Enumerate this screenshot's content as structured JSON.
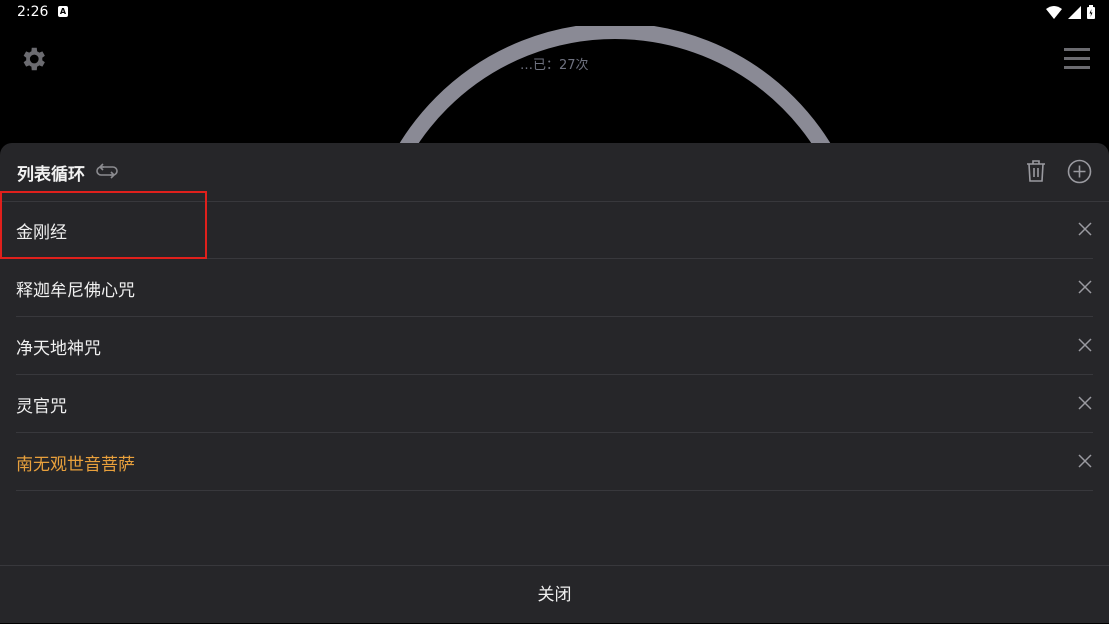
{
  "status_bar": {
    "time": "2:26",
    "notification_icon": "a-box-icon",
    "icons": [
      "wifi-icon",
      "signal-icon",
      "battery-icon"
    ]
  },
  "background": {
    "counter_text": "…已：27次",
    "left_icon": "gear-icon",
    "right_icon": "menu-icon",
    "refresh_icon": "refresh-icon",
    "accent_ring_color": "#8a8a95",
    "glow_color": "#1e3a9e"
  },
  "sheet": {
    "title": "列表循环",
    "title_icon": "loop-icon",
    "actions": [
      "trash-icon",
      "add-circle-icon"
    ],
    "items": [
      {
        "label": "金刚经",
        "active": false
      },
      {
        "label": "释迦牟尼佛心咒",
        "active": false
      },
      {
        "label": "净天地神咒",
        "active": false
      },
      {
        "label": "灵官咒",
        "active": false
      },
      {
        "label": "南无观世音菩萨",
        "active": true
      }
    ],
    "remove_icon": "close-icon",
    "close_label": "关闭",
    "active_color": "#e8a03c",
    "highlight_color": "#e0201c"
  }
}
